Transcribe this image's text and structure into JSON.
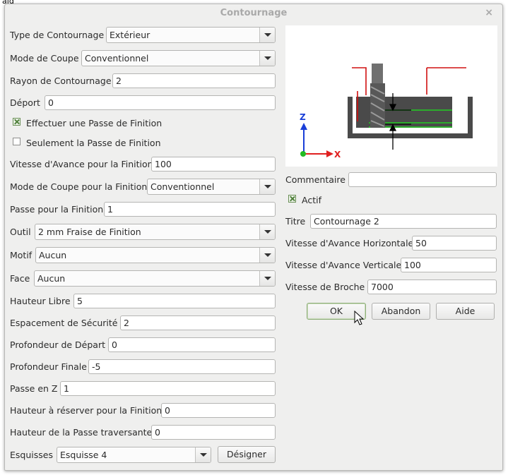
{
  "corner_text": "'aid",
  "window": {
    "title": "Contournage",
    "close_icon": "×"
  },
  "left": {
    "type_contournage": {
      "label": "Type de Contournage",
      "value": "Extérieur"
    },
    "mode_coupe": {
      "label": "Mode de Coupe",
      "value": "Conventionnel"
    },
    "rayon": {
      "label": "Rayon de Contournage",
      "value": "2"
    },
    "deport": {
      "label": "Déport",
      "value": "0"
    },
    "passe_finition_check": {
      "label": "Effectuer une Passe de Finition",
      "checked": true
    },
    "seulement_finition_check": {
      "label": "Seulement la Passe de Finition",
      "checked": false
    },
    "vitesse_finition": {
      "label": "Vitesse d'Avance pour la Finition",
      "value": "100"
    },
    "mode_coupe_finition": {
      "label": "Mode de Coupe pour la Finition",
      "value": "Conventionnel"
    },
    "passe_finition": {
      "label": "Passe pour la Finition",
      "value": "1"
    },
    "outil": {
      "label": "Outil",
      "value": "2 mm Fraise de Finition"
    },
    "motif": {
      "label": "Motif",
      "value": "Aucun"
    },
    "face": {
      "label": "Face",
      "value": "Aucun"
    },
    "hauteur_libre": {
      "label": "Hauteur Libre",
      "value": "5"
    },
    "espacement": {
      "label": "Espacement de Sécurité",
      "value": "2"
    },
    "prof_depart": {
      "label": "Profondeur de Départ",
      "value": "0"
    },
    "prof_finale": {
      "label": "Profondeur Finale",
      "value": "-5"
    },
    "passe_z": {
      "label": "Passe en Z",
      "value": "1"
    },
    "hauteur_reserver": {
      "label": "Hauteur à réserver pour la Finition",
      "value": "0"
    },
    "hauteur_traversante": {
      "label": "Hauteur de la Passe traversante",
      "value": "0"
    },
    "esquisses": {
      "label": "Esquisses",
      "value": "Esquisse 4",
      "button": "Désigner"
    }
  },
  "right": {
    "preview": {
      "axis_z": "Z",
      "axis_x": "X",
      "colors": {
        "axis": "#1a3fd8",
        "red": "#d01010",
        "green": "#22cc22"
      }
    },
    "commentaire": {
      "label": "Commentaire",
      "value": ""
    },
    "actif_check": {
      "label": "Actif",
      "checked": true
    },
    "titre": {
      "label": "Titre",
      "value": "Contournage 2"
    },
    "vitesse_horizontale": {
      "label": "Vitesse d'Avance Horizontale",
      "value": "50"
    },
    "vitesse_verticale": {
      "label": "Vitesse d'Avance Verticale",
      "value": "100"
    },
    "vitesse_broche": {
      "label": "Vitesse de Broche",
      "value": "7000"
    },
    "buttons": {
      "ok": "OK",
      "abandon": "Abandon",
      "aide": "Aide"
    }
  }
}
